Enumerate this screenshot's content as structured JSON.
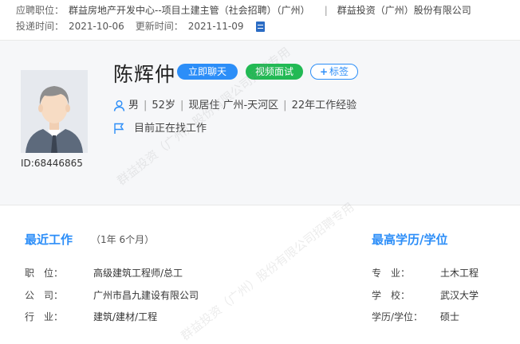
{
  "application": {
    "position_label": "应聘职位：",
    "position_value": "群益房地产开发中心--项目土建主管（社会招聘）（广州）",
    "separator": "|",
    "company": "群益投资（广州）股份有限公司",
    "applied_label": "投递时间：",
    "applied_date": "2021-10-06",
    "updated_label": "更新时间：",
    "updated_date": "2021-11-09"
  },
  "candidate": {
    "id_text": "ID:68446865",
    "name": "陈辉仲",
    "gender": "男",
    "age": "52岁",
    "residence": "现居住 广州-天河区",
    "experience": "22年工作经验",
    "status": "目前正在找工作"
  },
  "buttons": {
    "chat": "立即聊天",
    "video": "视频面试",
    "tag": "标签"
  },
  "recent_work": {
    "title": "最近工作",
    "duration": "（1年 6个月）",
    "rows": [
      {
        "label": "职　位：",
        "value": "高级建筑工程师/总工"
      },
      {
        "label": "公　司：",
        "value": "广州市昌九建设有限公司"
      },
      {
        "label": "行　业：",
        "value": "建筑/建材/工程"
      }
    ]
  },
  "education": {
    "title": "最高学历/学位",
    "rows": [
      {
        "label": "专　业：",
        "value": "土木工程"
      },
      {
        "label": "学　校：",
        "value": "武汉大学"
      },
      {
        "label": "学历/学位：",
        "value": "硕士"
      }
    ]
  },
  "watermark": {
    "line1": "群益投资（广州）股份有限公司招聘专用",
    "line2": "群益投资（广州）股份有限公司招聘专用"
  },
  "colors": {
    "accent": "#2c8ef8",
    "video": "#22b954",
    "icon_blue": "#2b6cc4"
  },
  "icons": [
    "resume-icon",
    "person-icon",
    "flag-icon",
    "plus-icon"
  ]
}
